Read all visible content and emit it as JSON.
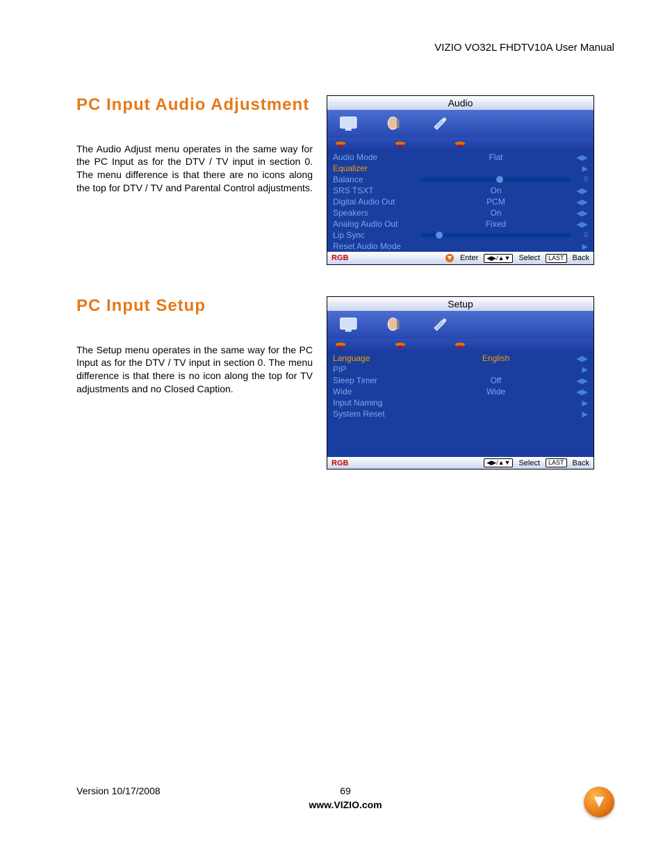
{
  "header": {
    "manual_title": "VIZIO VO32L FHDTV10A User Manual"
  },
  "sect1": {
    "heading": "PC Input Audio Adjustment",
    "body": "The Audio Adjust menu operates in the same way for the PC Input as for the DTV / TV input in section 0.  The menu difference is that there are no icons along the top for DTV / TV and Parental Control adjustments."
  },
  "sect2": {
    "heading": "PC Input Setup",
    "body": "The Setup menu operates in the same way for the PC Input as for the DTV / TV input in section 0.  The menu difference is that there is no icon along the top for TV adjustments and no Closed Caption."
  },
  "osd_audio": {
    "title": "Audio",
    "rows": [
      {
        "label": "Audio Mode",
        "value": "Flat",
        "ind": "↔",
        "num": ""
      },
      {
        "label": "Equalizer",
        "value": "",
        "ind": "▶",
        "hl": true
      },
      {
        "label": "Balance",
        "slider": true,
        "knob": 50,
        "num": "0"
      },
      {
        "label": "SRS TSXT",
        "value": "On",
        "ind": "↔"
      },
      {
        "label": "Digital Audio Out",
        "value": "PCM",
        "ind": "↔"
      },
      {
        "label": "Speakers",
        "value": "On",
        "ind": "↔"
      },
      {
        "label": "Analog Audio Out",
        "value": "Fixed",
        "ind": "↔"
      },
      {
        "label": "Lip Sync",
        "slider": true,
        "knob": 10,
        "num": "0"
      },
      {
        "label": "Reset Audio Mode",
        "value": "",
        "ind": "▶"
      }
    ],
    "source": "RGB",
    "footer_enter": "Enter",
    "footer_select": "Select",
    "footer_back": "Back",
    "key_last": "LAST",
    "key_nav": "◀▶/▲▼"
  },
  "osd_setup": {
    "title": "Setup",
    "rows": [
      {
        "label": "Language",
        "value": "English",
        "ind": "↔",
        "hl": true
      },
      {
        "label": "PIP",
        "value": "",
        "ind": "▶"
      },
      {
        "label": "Sleep Timer",
        "value": "Off",
        "ind": "↔"
      },
      {
        "label": "Wide",
        "value": "Wide",
        "ind": "↔"
      },
      {
        "label": "Input Naming",
        "value": "",
        "ind": "▶"
      },
      {
        "label": "System Reset",
        "value": "",
        "ind": "▶"
      }
    ],
    "source": "RGB",
    "footer_select": "Select",
    "footer_back": "Back",
    "key_last": "LAST",
    "key_nav": "◀▶/▲▼"
  },
  "footer": {
    "version": "Version 10/17/2008",
    "page": "69",
    "url": "www.VIZIO.com"
  }
}
